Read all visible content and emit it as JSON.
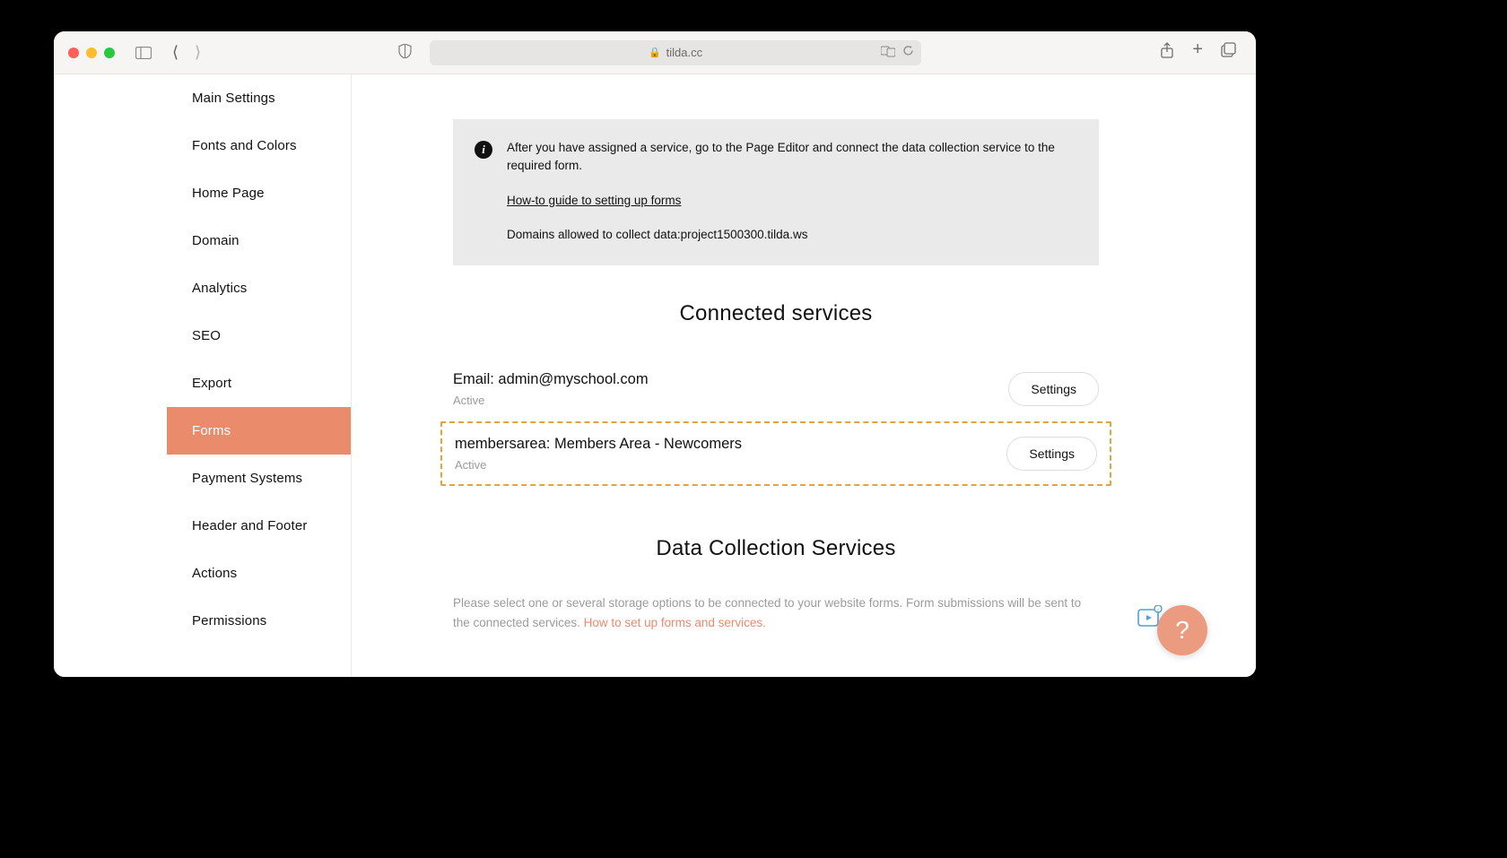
{
  "browser": {
    "url_host": "tilda.cc"
  },
  "sidebar": {
    "items": [
      {
        "label": "Main Settings"
      },
      {
        "label": "Fonts and Colors"
      },
      {
        "label": "Home Page"
      },
      {
        "label": "Domain"
      },
      {
        "label": "Analytics"
      },
      {
        "label": "SEO"
      },
      {
        "label": "Export"
      },
      {
        "label": "Forms"
      },
      {
        "label": "Payment Systems"
      },
      {
        "label": "Header and Footer"
      },
      {
        "label": "Actions"
      },
      {
        "label": "Permissions"
      }
    ],
    "active_index": 7
  },
  "info_banner": {
    "text": "After you have assigned a service, go to the Page Editor and connect the data collection service to the required form.",
    "link_text": "How-to guide to setting up forms",
    "domains_text": "Domains allowed to collect data:project1500300.tilda.ws"
  },
  "connected_services": {
    "title": "Connected services",
    "items": [
      {
        "name": "Email: admin@myschool.com",
        "status": "Active",
        "button": "Settings",
        "highlighted": false
      },
      {
        "name": "membersarea: Members Area - Newcomers",
        "status": "Active",
        "button": "Settings",
        "highlighted": true
      }
    ]
  },
  "data_collection": {
    "title": "Data Collection Services",
    "desc_prefix": "Please select one or several storage options to be connected to your website forms. Form submissions will be sent to the connected services. ",
    "desc_link": "How to set up forms and services."
  },
  "help_button": {
    "label": "?"
  }
}
